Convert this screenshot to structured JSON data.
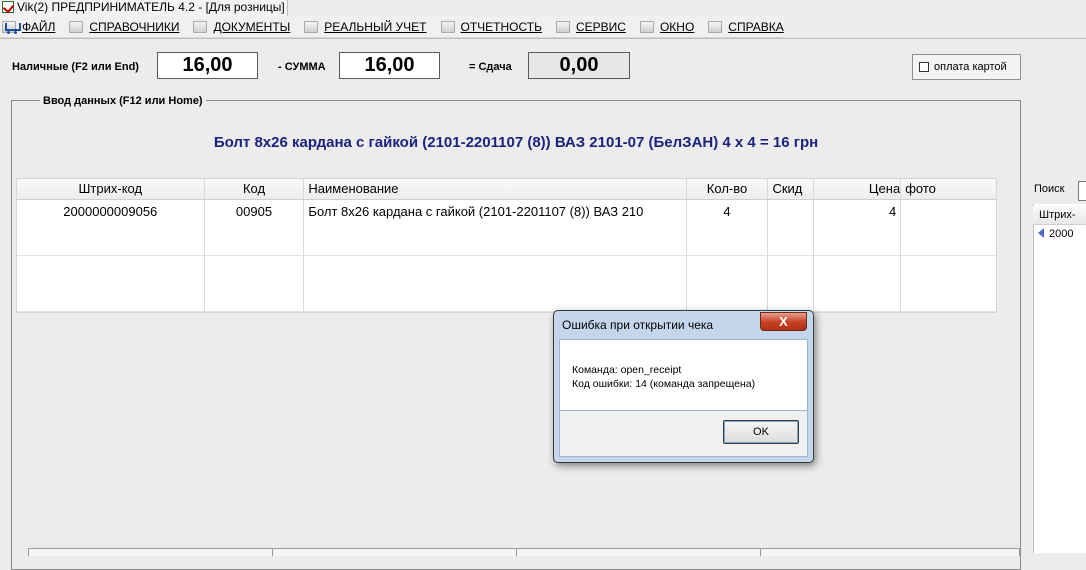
{
  "window": {
    "title": "Vik(2)  ПРЕДПРИНИМАТЕЛЬ 4.2 - [Для розницы]"
  },
  "menu": {
    "items": [
      {
        "label": "ФАЙЛ",
        "icon": "folder-icon"
      },
      {
        "label": "СПРАВОЧНИКИ",
        "icon": "book-icon"
      },
      {
        "label": "ДОКУМЕНТЫ",
        "icon": "document-icon"
      },
      {
        "label": "РЕАЛЬНЫЙ УЧЕТ",
        "icon": "ledger-icon"
      },
      {
        "label": "ОТЧЕТНОСТЬ",
        "icon": "report-icon"
      },
      {
        "label": "СЕРВИС",
        "icon": "service-icon"
      },
      {
        "label": "ОКНО",
        "icon": "window-icon"
      },
      {
        "label": "СПРАВКА",
        "icon": "help-icon"
      }
    ]
  },
  "payment": {
    "cash_label": "Наличные (F2 или End)",
    "cash_value": "16,00",
    "sum_label": "- СУММА",
    "sum_value": "16,00",
    "change_label": "= Сдача",
    "change_value": "0,00",
    "card_label": "оплата картой"
  },
  "input_group": {
    "title": "Ввод данных (F12 или Home)"
  },
  "product_title": "Болт 8х26 кардана с гайкой (2101-2201107 (8)) ВАЗ 2101-07 (БелЗАН)   4 х 4 = 16 грн",
  "table": {
    "headers": [
      "Штрих-код",
      "Код",
      "Наименование",
      "Кол-во",
      "Скид",
      "Цена",
      "фото"
    ],
    "rows": [
      [
        "2000000009056",
        "00905",
        "Болт 8х26 кардана с гайкой (2101-2201107 (8)) ВАЗ 210",
        "4",
        "",
        "4",
        ""
      ]
    ]
  },
  "side_panel": {
    "search_label": "Поиск",
    "header": "Штрих-",
    "row_value": "2000"
  },
  "dialog": {
    "title": "Ошибка при открытии чека",
    "close_label": "X",
    "line1": "Команда:  open_receipt",
    "line2": "Код ошибки:  14 (команда запрещена)",
    "ok_label": "OK"
  },
  "colors": {
    "product_title": "#1a237e",
    "close_button": "#c8452a"
  }
}
